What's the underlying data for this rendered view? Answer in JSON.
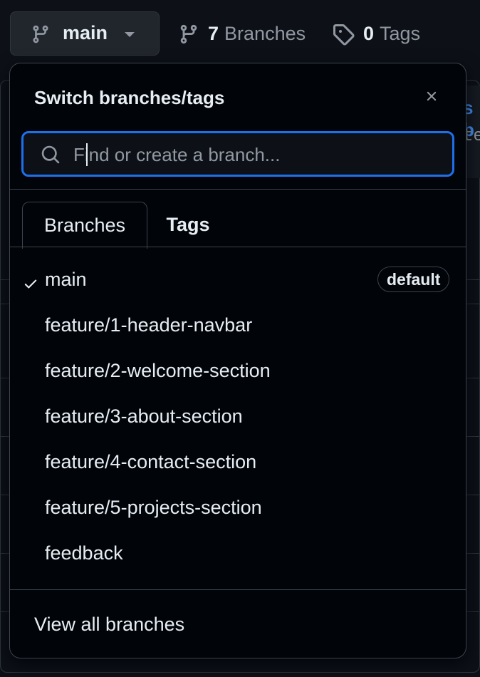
{
  "toolbar": {
    "branch_button_label": "main",
    "branches_count": "7",
    "branches_label": "Branches",
    "tags_count": "0",
    "tags_label": "Tags"
  },
  "background": {
    "blue_fragment": "s b",
    "gray_fragment": "te"
  },
  "dropdown": {
    "title": "Switch branches/tags",
    "search_placeholder": "Find or create a branch...",
    "tabs": [
      {
        "label": "Branches",
        "active": true
      },
      {
        "label": "Tags",
        "active": false
      }
    ],
    "branches": [
      {
        "label": "main",
        "selected": true,
        "badge": "default"
      },
      {
        "label": "feature/1-header-navbar",
        "selected": false
      },
      {
        "label": "feature/2-welcome-section",
        "selected": false
      },
      {
        "label": "feature/3-about-section",
        "selected": false
      },
      {
        "label": "feature/4-contact-section",
        "selected": false
      },
      {
        "label": "feature/5-projects-section",
        "selected": false
      },
      {
        "label": "feedback",
        "selected": false
      }
    ],
    "footer_link": "View all branches"
  },
  "colors": {
    "accent_blue": "#1f6feb",
    "link_blue": "#4493f8",
    "text": "#e6edf3",
    "muted": "#9198a1",
    "panel_bg": "#010409",
    "page_bg": "#0d1117"
  }
}
